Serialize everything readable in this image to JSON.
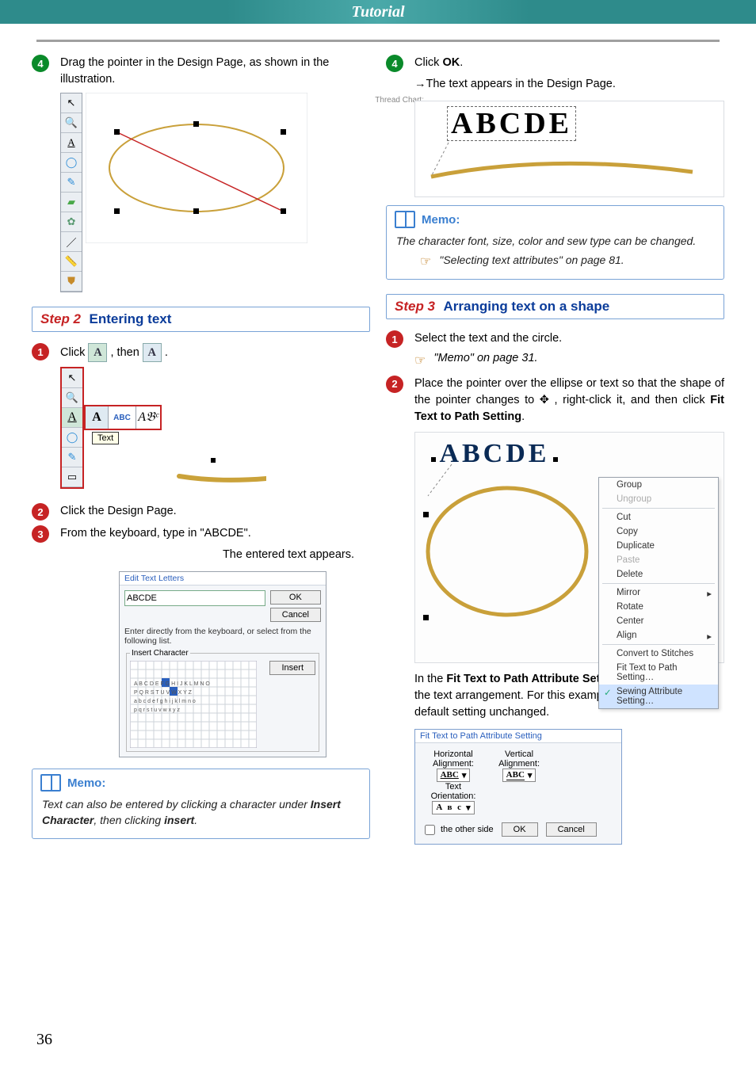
{
  "header": {
    "title": "Tutorial"
  },
  "page_number": "36",
  "left": {
    "n4": {
      "text": "Drag the pointer in the Design Page, as shown in the illustration.",
      "thread_chart_label": "Thread Chart:"
    },
    "step2": {
      "prefix": "Step 2",
      "title": "Entering text"
    },
    "n1": {
      "pre": "Click ",
      "mid": " , then ",
      "post": " ."
    },
    "toolbar_popup": {
      "text_label": "Text",
      "abc_label": "ABC"
    },
    "n2": {
      "text": "Click the Design Page."
    },
    "n3": {
      "text": "From the keyboard, type in \"ABCDE\".",
      "caption": "The entered text appears.",
      "dialog": {
        "title": "Edit Text Letters",
        "value": "ABCDE",
        "ok": "OK",
        "cancel": "Cancel",
        "hint": "Enter directly from the keyboard, or select from the following list.",
        "group": "Insert Character",
        "insert": "Insert"
      }
    },
    "memo": {
      "heading": "Memo:",
      "body_pre": "Text can also be entered by clicking a character under ",
      "body_bold1": "Insert Character",
      "body_mid": ", then clicking ",
      "body_bold2": "insert",
      "body_post": "."
    }
  },
  "right": {
    "n4": {
      "pre": "Click ",
      "bold": "OK",
      "post": ".",
      "result": "The text appears in the Design Page.",
      "sample_text": "ABCDE"
    },
    "memo": {
      "heading": "Memo:",
      "body": "The character font, size, color and sew type can be changed.",
      "ref": "\"Selecting text attributes\" on page 81."
    },
    "step3": {
      "prefix": "Step 3",
      "title": "Arranging text on a shape"
    },
    "n1": {
      "text": "Select the text and the circle.",
      "ref": "\"Memo\" on page 31."
    },
    "n2": {
      "line1": "Place the pointer over the ellipse or text so that the shape of the pointer changes to ",
      "line2": " , right-click it, and then click ",
      "bold": "Fit Text to Path Setting",
      "post": ".",
      "sample_text": "ABCDE",
      "menu": {
        "group": "Group",
        "ungroup": "Ungroup",
        "cut": "Cut",
        "copy": "Copy",
        "duplicate": "Duplicate",
        "paste": "Paste",
        "delete": "Delete",
        "mirror": "Mirror",
        "rotate": "Rotate",
        "center": "Center",
        "align": "Align",
        "convert": "Convert to Stitches",
        "fit": "Fit Text to Path Setting…",
        "sew": "Sewing Attribute Setting…"
      },
      "after_pre": "In the ",
      "after_bold": "Fit Text to Path Attribute Setting",
      "after_post": " dialog box, select the text arrangement. For this example, we will leave the default setting unchanged."
    },
    "dialog": {
      "title": "Fit Text to Path Attribute Setting",
      "h_label": "Horizontal Alignment:",
      "v_label": "Vertical Alignment:",
      "t_label": "Text Orientation:",
      "sample": "ABC",
      "other_side": "the other side",
      "ok": "OK",
      "cancel": "Cancel"
    }
  }
}
